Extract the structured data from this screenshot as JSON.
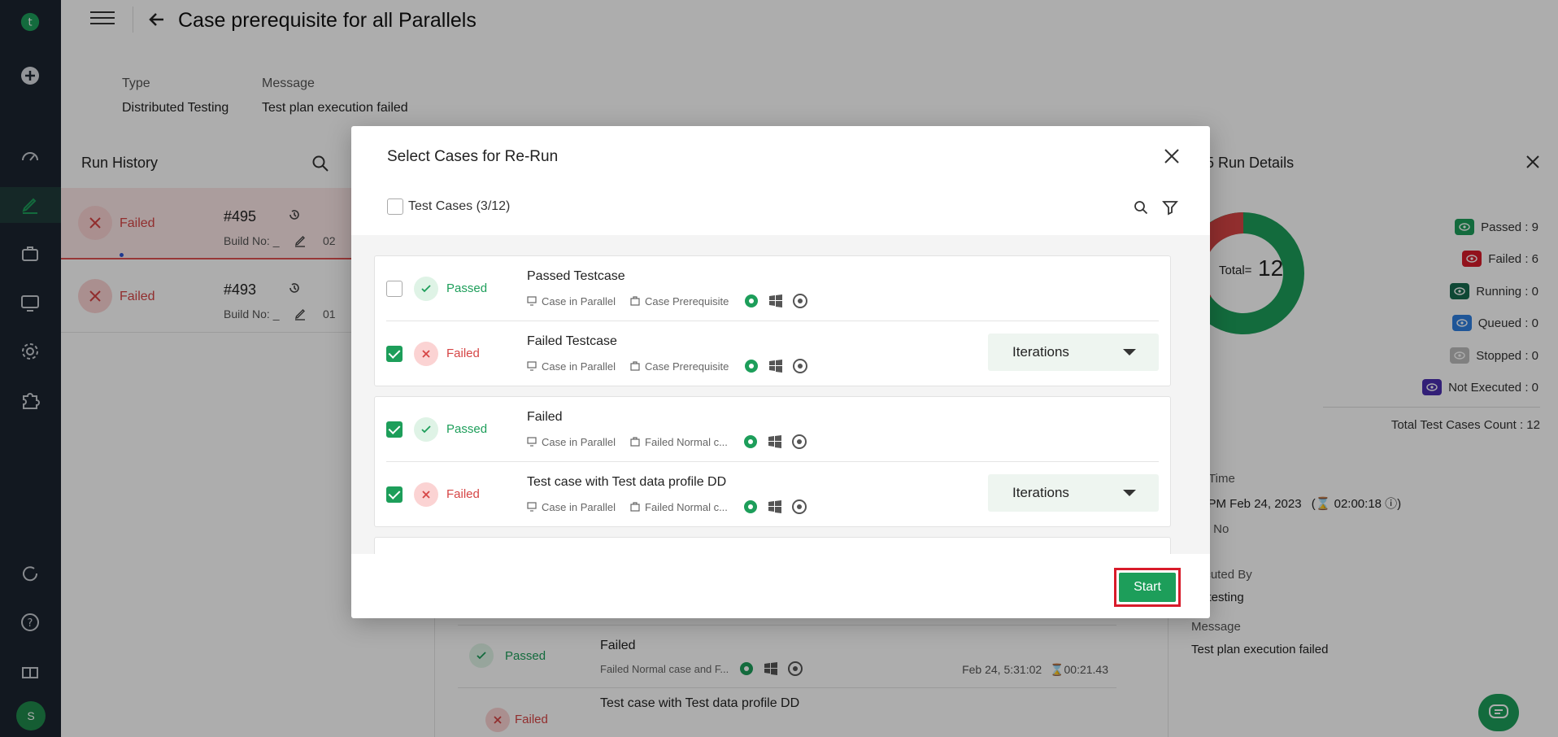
{
  "header": {
    "title": "Case prerequisite for all Parallels",
    "type_label": "Type",
    "type_value": "Distributed Testing",
    "message_label": "Message",
    "message_value": "Test plan execution failed"
  },
  "run_history": {
    "title": "Run History",
    "runs": [
      {
        "status": "Failed",
        "number": "#495",
        "build": "Build No: _",
        "duration": "02"
      },
      {
        "status": "Failed",
        "number": "#493",
        "build": "Build No: _",
        "duration": "01"
      }
    ]
  },
  "background_list": [
    {
      "status": "Passed",
      "name": "Failed",
      "sub": "Failed Normal case and F...",
      "date": "Feb 24, 5:31:02",
      "duration": "00:21.43"
    },
    {
      "status": "Failed",
      "name": "Test case with Test data profile DD"
    }
  ],
  "run_details": {
    "title": "95 Run Details",
    "total_label": "Total=",
    "total_value": "12",
    "legend": [
      {
        "label": "Passed : 9",
        "color": "#1d9e5a"
      },
      {
        "label": "Failed : 6",
        "color": "#d81b2a"
      },
      {
        "label": "Running : 0",
        "color": "#176b4f"
      },
      {
        "label": "Queued : 0",
        "color": "#2f7fe0"
      },
      {
        "label": "Stopped : 0",
        "color": "#bdbdbd"
      },
      {
        "label": "Not Executed : 0",
        "color": "#4b2fb0"
      }
    ],
    "total_count": "Total Test Cases Count : 12",
    "start_time_label": "rt Time",
    "start_time_value": "4 PM Feb 24, 2023",
    "duration": "02:00:18",
    "build_label": "ild No",
    "build_value": "_",
    "executed_by_label": "ecuted By",
    "executed_by_value": "n testing",
    "message_label": "Message",
    "message_value": "Test plan execution failed"
  },
  "modal": {
    "title": "Select Cases for Re-Run",
    "test_cases_label": "Test Cases (3/12)",
    "start_label": "Start",
    "groups": [
      {
        "cases": [
          {
            "checked": false,
            "status": "Passed",
            "name": "Passed Testcase",
            "mode": "Case in Parallel",
            "suite": "Case Prerequisite",
            "iterations": false
          },
          {
            "checked": true,
            "status": "Failed",
            "name": "Failed Testcase",
            "mode": "Case in Parallel",
            "suite": "Case Prerequisite",
            "iterations": true
          }
        ]
      },
      {
        "cases": [
          {
            "checked": true,
            "status": "Passed",
            "name": "Failed",
            "mode": "Case in Parallel",
            "suite": "Failed Normal c...",
            "iterations": false
          },
          {
            "checked": true,
            "status": "Failed",
            "name": "Test case with Test data profile DD",
            "mode": "Case in Parallel",
            "suite": "Failed Normal c...",
            "iterations": true
          }
        ]
      }
    ],
    "iterations_label": "Iterations"
  },
  "avatar_letter": "S"
}
